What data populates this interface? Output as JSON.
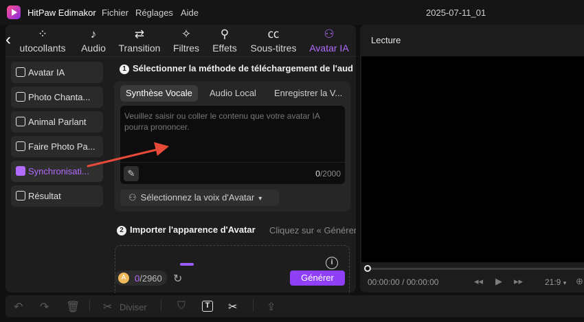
{
  "titlebar": {
    "app_title": "HitPaw Edimakor",
    "menu": [
      "Fichier",
      "Réglages",
      "Aide"
    ],
    "project_name": "2025-07-11_01"
  },
  "tabs": [
    {
      "label": "Autocollants",
      "icon": "sticker-icon",
      "visible_label": "utocollants"
    },
    {
      "label": "Audio",
      "icon": "music-note-icon"
    },
    {
      "label": "Transition",
      "icon": "transition-arrows-icon"
    },
    {
      "label": "Filtres",
      "icon": "sparkle-icon"
    },
    {
      "label": "Effets",
      "icon": "magic-wand-icon"
    },
    {
      "label": "Sous-titres",
      "icon": "cc-icon"
    },
    {
      "label": "Avatar IA",
      "icon": "avatar-ai-icon",
      "active": true
    }
  ],
  "sidebar": {
    "items": [
      {
        "label": "Avatar IA",
        "icon": "avatar-icon"
      },
      {
        "label": "Photo Chanta...",
        "icon": "photo-sing-icon"
      },
      {
        "label": "Animal Parlant",
        "icon": "animal-icon"
      },
      {
        "label": "Faire Photo Pa...",
        "icon": "photo-talk-icon"
      },
      {
        "label": "Synchronisati...",
        "icon": "sync-icon",
        "active": true
      },
      {
        "label": "Résultat",
        "icon": "result-icon"
      }
    ]
  },
  "step1": {
    "number": "1",
    "title": "Sélectionner la méthode de téléchargement de l'aud",
    "subtabs": [
      "Synthèse Vocale",
      "Audio Local",
      "Enregistrer la V..."
    ],
    "textarea_placeholder": "Veuillez saisir ou coller le contenu que votre avatar IA pourra prononcer.",
    "char_count": "0",
    "char_limit": "/2000",
    "voice_button": "Sélectionnez la voix d'Avatar"
  },
  "step2": {
    "number": "2",
    "title": "Importer l'apparence d'Avatar",
    "hint": "Cliquez sur « Générer"
  },
  "footer": {
    "credits_used": "0",
    "credits_total": "/2960",
    "generate_button": "Générer"
  },
  "preview": {
    "title": "Lecture",
    "time_current": "00:00:00",
    "time_total": "/ 00:00:00",
    "aspect_ratio": "21:9",
    "progress": 0
  },
  "toolbar": {
    "split_label": "Diviser"
  },
  "colors": {
    "accent": "#b26bff",
    "generate_button": "#8f3ff5",
    "arrow": "#e84a3a"
  }
}
